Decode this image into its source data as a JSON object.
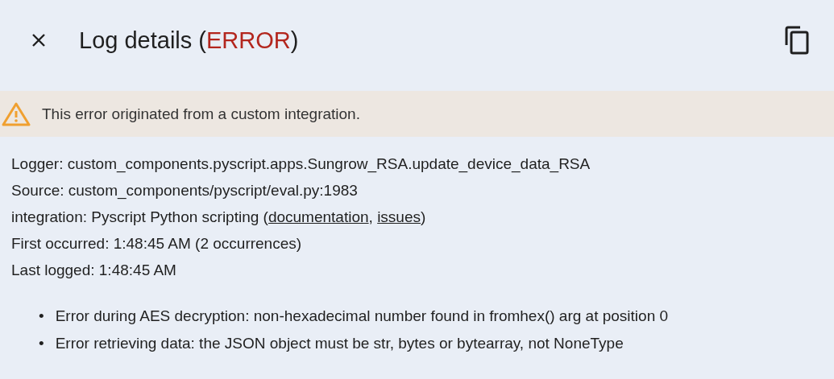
{
  "header": {
    "title_prefix": "Log details (",
    "level": "ERROR",
    "title_suffix": ")"
  },
  "warning": {
    "text": "This error originated from a custom integration."
  },
  "details": [
    {
      "segments": [
        {
          "kind": "text",
          "text": "Logger: custom_components.pyscript.apps.Sungrow_RSA.update_device_data_RSA"
        }
      ]
    },
    {
      "segments": [
        {
          "kind": "text",
          "text": "Source: custom_components/pyscript/eval.py:1983"
        }
      ]
    },
    {
      "segments": [
        {
          "kind": "text",
          "text": "integration: Pyscript Python scripting ("
        },
        {
          "kind": "link",
          "text": "documentation"
        },
        {
          "kind": "text",
          "text": ", "
        },
        {
          "kind": "link",
          "text": "issues"
        },
        {
          "kind": "text",
          "text": ")"
        }
      ]
    },
    {
      "segments": [
        {
          "kind": "text",
          "text": "First occurred: 1:48:45 AM (2 occurrences)"
        }
      ]
    },
    {
      "segments": [
        {
          "kind": "text",
          "text": "Last logged: 1:48:45 AM"
        }
      ]
    }
  ],
  "messages": [
    {
      "bullet": "•",
      "text": "Error during AES decryption: non-hexadecimal number found in fromhex() arg at position 0"
    },
    {
      "bullet": "•",
      "text": "Error retrieving data: the JSON object must be str, bytes or bytearray, not NoneType"
    }
  ]
}
